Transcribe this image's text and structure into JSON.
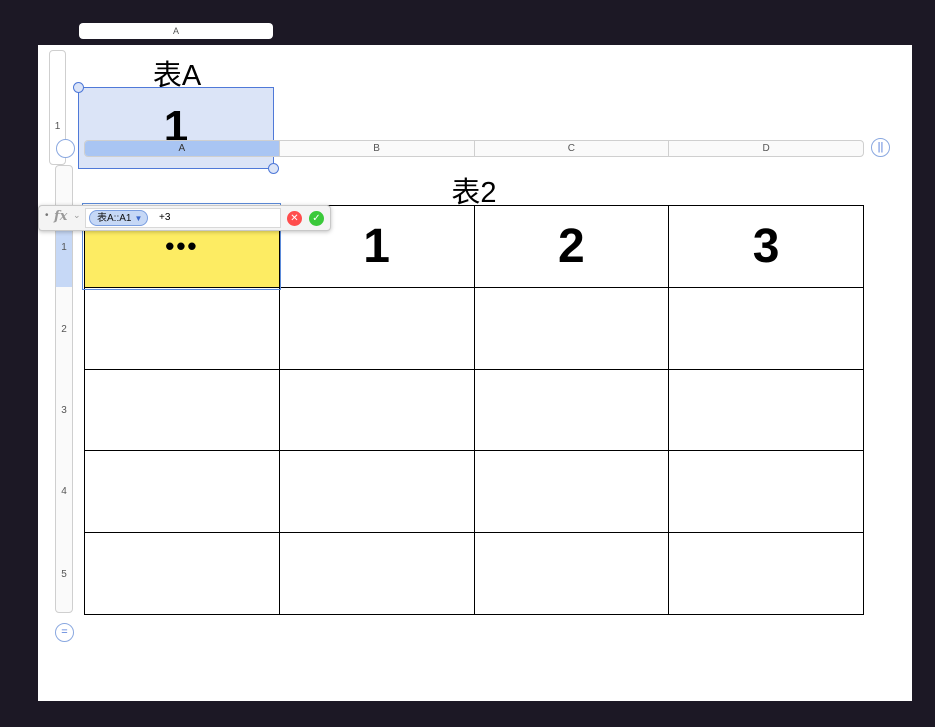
{
  "tableA": {
    "title": "表A",
    "column_header": "A",
    "row_header": "1",
    "cell_value": "1"
  },
  "table2": {
    "title": "表2",
    "columns": [
      "A",
      "B",
      "C",
      "D"
    ],
    "rows": [
      "1",
      "2",
      "3",
      "4",
      "5"
    ],
    "cells": [
      [
        "•••",
        "1",
        "2",
        "3"
      ],
      [
        "",
        "",
        "",
        ""
      ],
      [
        "",
        "",
        "",
        ""
      ],
      [
        "",
        "",
        "",
        ""
      ],
      [
        "",
        "",
        "",
        ""
      ]
    ],
    "pause_icon_label": "||",
    "add_row_icon_label": "="
  },
  "formula_bar": {
    "reference": "表A::A1",
    "operator_text": "+3",
    "cancel_label": "✕",
    "accept_label": "✓"
  },
  "colors": {
    "highlight": "#fdec63",
    "selection": "#4f79d8",
    "background": "#1c1825"
  }
}
